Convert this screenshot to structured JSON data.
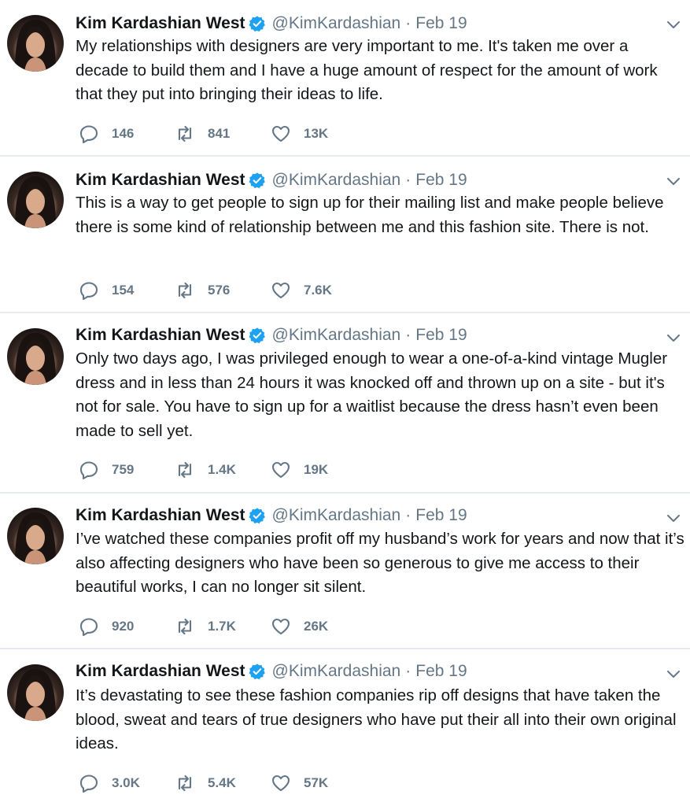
{
  "tweets": [
    {
      "name": "Kim Kardashian West",
      "handle": "@KimKardashian",
      "separator": "·",
      "date": "Feb 19",
      "text": "My relationships with designers are very important to me. It's taken me over a decade to build them and I have a huge amount of respect for the amount of work that they put into bringing their ideas to life.",
      "replies": "146",
      "retweets": "841",
      "likes": "13K"
    },
    {
      "name": "Kim Kardashian West",
      "handle": "@KimKardashian",
      "separator": "·",
      "date": "Feb 19",
      "text": "This is a way to get people to sign up for their mailing list and make people believe there is some kind of relationship between me and this fashion site. There is not.",
      "replies": "154",
      "retweets": "576",
      "likes": "7.6K"
    },
    {
      "name": "Kim Kardashian West",
      "handle": "@KimKardashian",
      "separator": "·",
      "date": "Feb 19",
      "text": "Only two days ago, I was privileged enough to wear a one-of-a-kind vintage Mugler dress and in less than 24 hours it was knocked off and thrown up on a site - but it's not for sale. You have to sign up for a waitlist because the dress hasn’t even been made to sell yet.",
      "replies": "759",
      "retweets": "1.4K",
      "likes": "19K"
    },
    {
      "name": "Kim Kardashian West",
      "handle": "@KimKardashian",
      "separator": "·",
      "date": "Feb 19",
      "text": "I’ve watched these companies profit off my husband’s work for years and now that it’s also affecting designers who have been so generous to give me access to their beautiful works, I can no longer sit silent.",
      "replies": "920",
      "retweets": "1.7K",
      "likes": "26K"
    },
    {
      "name": "Kim Kardashian West",
      "handle": "@KimKardashian",
      "separator": "·",
      "date": "Feb 19",
      "text": "It’s devastating to see these fashion companies rip off designs that have taken the blood, sweat and tears of true designers who have put their all into their own original ideas.",
      "replies": "3.0K",
      "retweets": "5.4K",
      "likes": "57K"
    }
  ],
  "icons": {
    "avatar": "profile-photo",
    "verified": "verified-badge-icon",
    "caret": "chevron-down-icon",
    "reply": "reply-icon",
    "retweet": "retweet-icon",
    "like": "heart-icon"
  },
  "colors": {
    "text": "#14171a",
    "secondary": "#657786",
    "verified": "#1da1f2",
    "divider": "#e6ecf0"
  }
}
